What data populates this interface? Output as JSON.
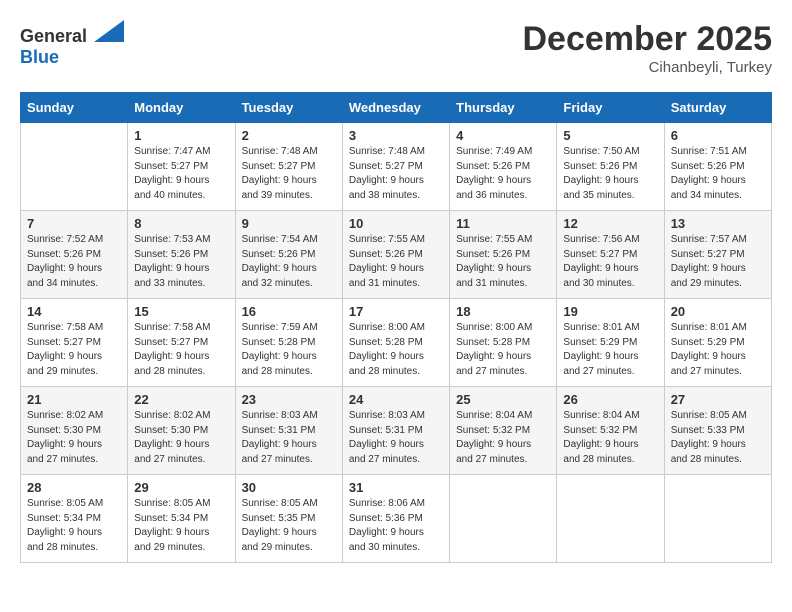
{
  "logo": {
    "general": "General",
    "blue": "Blue"
  },
  "title": "December 2025",
  "subtitle": "Cihanbeyli, Turkey",
  "headers": [
    "Sunday",
    "Monday",
    "Tuesday",
    "Wednesday",
    "Thursday",
    "Friday",
    "Saturday"
  ],
  "weeks": [
    [
      {
        "day": "",
        "sunrise": "",
        "sunset": "",
        "daylight": ""
      },
      {
        "day": "1",
        "sunrise": "Sunrise: 7:47 AM",
        "sunset": "Sunset: 5:27 PM",
        "daylight": "Daylight: 9 hours and 40 minutes."
      },
      {
        "day": "2",
        "sunrise": "Sunrise: 7:48 AM",
        "sunset": "Sunset: 5:27 PM",
        "daylight": "Daylight: 9 hours and 39 minutes."
      },
      {
        "day": "3",
        "sunrise": "Sunrise: 7:48 AM",
        "sunset": "Sunset: 5:27 PM",
        "daylight": "Daylight: 9 hours and 38 minutes."
      },
      {
        "day": "4",
        "sunrise": "Sunrise: 7:49 AM",
        "sunset": "Sunset: 5:26 PM",
        "daylight": "Daylight: 9 hours and 36 minutes."
      },
      {
        "day": "5",
        "sunrise": "Sunrise: 7:50 AM",
        "sunset": "Sunset: 5:26 PM",
        "daylight": "Daylight: 9 hours and 35 minutes."
      },
      {
        "day": "6",
        "sunrise": "Sunrise: 7:51 AM",
        "sunset": "Sunset: 5:26 PM",
        "daylight": "Daylight: 9 hours and 34 minutes."
      }
    ],
    [
      {
        "day": "7",
        "sunrise": "Sunrise: 7:52 AM",
        "sunset": "Sunset: 5:26 PM",
        "daylight": "Daylight: 9 hours and 34 minutes."
      },
      {
        "day": "8",
        "sunrise": "Sunrise: 7:53 AM",
        "sunset": "Sunset: 5:26 PM",
        "daylight": "Daylight: 9 hours and 33 minutes."
      },
      {
        "day": "9",
        "sunrise": "Sunrise: 7:54 AM",
        "sunset": "Sunset: 5:26 PM",
        "daylight": "Daylight: 9 hours and 32 minutes."
      },
      {
        "day": "10",
        "sunrise": "Sunrise: 7:55 AM",
        "sunset": "Sunset: 5:26 PM",
        "daylight": "Daylight: 9 hours and 31 minutes."
      },
      {
        "day": "11",
        "sunrise": "Sunrise: 7:55 AM",
        "sunset": "Sunset: 5:26 PM",
        "daylight": "Daylight: 9 hours and 31 minutes."
      },
      {
        "day": "12",
        "sunrise": "Sunrise: 7:56 AM",
        "sunset": "Sunset: 5:27 PM",
        "daylight": "Daylight: 9 hours and 30 minutes."
      },
      {
        "day": "13",
        "sunrise": "Sunrise: 7:57 AM",
        "sunset": "Sunset: 5:27 PM",
        "daylight": "Daylight: 9 hours and 29 minutes."
      }
    ],
    [
      {
        "day": "14",
        "sunrise": "Sunrise: 7:58 AM",
        "sunset": "Sunset: 5:27 PM",
        "daylight": "Daylight: 9 hours and 29 minutes."
      },
      {
        "day": "15",
        "sunrise": "Sunrise: 7:58 AM",
        "sunset": "Sunset: 5:27 PM",
        "daylight": "Daylight: 9 hours and 28 minutes."
      },
      {
        "day": "16",
        "sunrise": "Sunrise: 7:59 AM",
        "sunset": "Sunset: 5:28 PM",
        "daylight": "Daylight: 9 hours and 28 minutes."
      },
      {
        "day": "17",
        "sunrise": "Sunrise: 8:00 AM",
        "sunset": "Sunset: 5:28 PM",
        "daylight": "Daylight: 9 hours and 28 minutes."
      },
      {
        "day": "18",
        "sunrise": "Sunrise: 8:00 AM",
        "sunset": "Sunset: 5:28 PM",
        "daylight": "Daylight: 9 hours and 27 minutes."
      },
      {
        "day": "19",
        "sunrise": "Sunrise: 8:01 AM",
        "sunset": "Sunset: 5:29 PM",
        "daylight": "Daylight: 9 hours and 27 minutes."
      },
      {
        "day": "20",
        "sunrise": "Sunrise: 8:01 AM",
        "sunset": "Sunset: 5:29 PM",
        "daylight": "Daylight: 9 hours and 27 minutes."
      }
    ],
    [
      {
        "day": "21",
        "sunrise": "Sunrise: 8:02 AM",
        "sunset": "Sunset: 5:30 PM",
        "daylight": "Daylight: 9 hours and 27 minutes."
      },
      {
        "day": "22",
        "sunrise": "Sunrise: 8:02 AM",
        "sunset": "Sunset: 5:30 PM",
        "daylight": "Daylight: 9 hours and 27 minutes."
      },
      {
        "day": "23",
        "sunrise": "Sunrise: 8:03 AM",
        "sunset": "Sunset: 5:31 PM",
        "daylight": "Daylight: 9 hours and 27 minutes."
      },
      {
        "day": "24",
        "sunrise": "Sunrise: 8:03 AM",
        "sunset": "Sunset: 5:31 PM",
        "daylight": "Daylight: 9 hours and 27 minutes."
      },
      {
        "day": "25",
        "sunrise": "Sunrise: 8:04 AM",
        "sunset": "Sunset: 5:32 PM",
        "daylight": "Daylight: 9 hours and 27 minutes."
      },
      {
        "day": "26",
        "sunrise": "Sunrise: 8:04 AM",
        "sunset": "Sunset: 5:32 PM",
        "daylight": "Daylight: 9 hours and 28 minutes."
      },
      {
        "day": "27",
        "sunrise": "Sunrise: 8:05 AM",
        "sunset": "Sunset: 5:33 PM",
        "daylight": "Daylight: 9 hours and 28 minutes."
      }
    ],
    [
      {
        "day": "28",
        "sunrise": "Sunrise: 8:05 AM",
        "sunset": "Sunset: 5:34 PM",
        "daylight": "Daylight: 9 hours and 28 minutes."
      },
      {
        "day": "29",
        "sunrise": "Sunrise: 8:05 AM",
        "sunset": "Sunset: 5:34 PM",
        "daylight": "Daylight: 9 hours and 29 minutes."
      },
      {
        "day": "30",
        "sunrise": "Sunrise: 8:05 AM",
        "sunset": "Sunset: 5:35 PM",
        "daylight": "Daylight: 9 hours and 29 minutes."
      },
      {
        "day": "31",
        "sunrise": "Sunrise: 8:06 AM",
        "sunset": "Sunset: 5:36 PM",
        "daylight": "Daylight: 9 hours and 30 minutes."
      },
      {
        "day": "",
        "sunrise": "",
        "sunset": "",
        "daylight": ""
      },
      {
        "day": "",
        "sunrise": "",
        "sunset": "",
        "daylight": ""
      },
      {
        "day": "",
        "sunrise": "",
        "sunset": "",
        "daylight": ""
      }
    ]
  ]
}
